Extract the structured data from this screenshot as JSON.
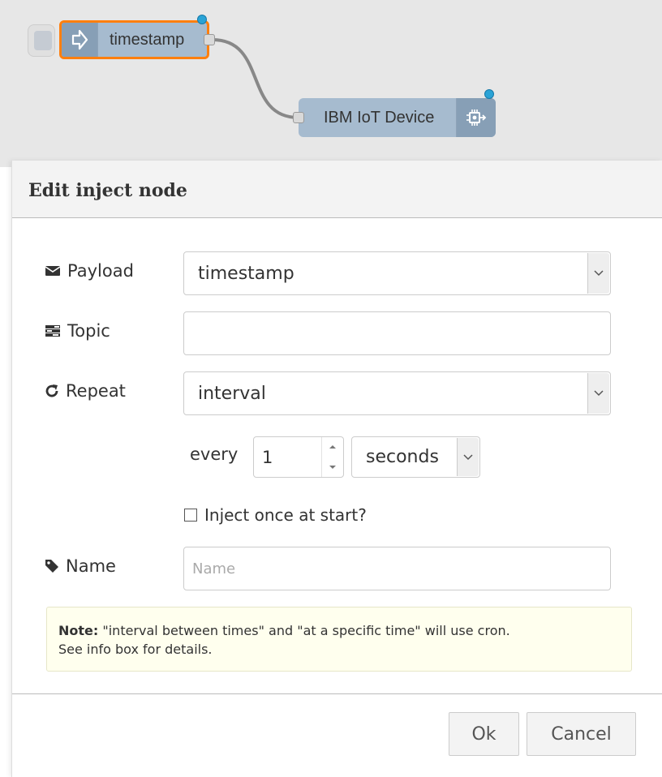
{
  "flow": {
    "inject_node": {
      "label": "timestamp",
      "icon": "arrow-right-icon"
    },
    "iot_node": {
      "label": "IBM IoT Device",
      "icon": "chip-icon"
    }
  },
  "dialog": {
    "title": "Edit inject node",
    "payload": {
      "label": "Payload",
      "icon": "envelope-icon",
      "value": "timestamp"
    },
    "topic": {
      "label": "Topic",
      "icon": "tasks-icon",
      "value": ""
    },
    "repeat": {
      "label": "Repeat",
      "icon": "repeat-icon",
      "value": "interval"
    },
    "every": {
      "label": "every",
      "value": "1",
      "unit": "seconds"
    },
    "inject_once": {
      "label": "Inject once at start?",
      "checked": false
    },
    "name": {
      "label": "Name",
      "icon": "tag-icon",
      "placeholder": "Name",
      "value": ""
    },
    "note": {
      "bold": "Note:",
      "text": " \"interval between times\" and \"at a specific time\" will use cron.",
      "line2": "See info box for details."
    },
    "buttons": {
      "ok": "Ok",
      "cancel": "Cancel"
    }
  },
  "colors": {
    "node_fill": "#a6bbcf",
    "selected_border": "#ff7f0e",
    "status_dot": "#2aa3d6",
    "canvas_bg": "#e7e7e7"
  }
}
